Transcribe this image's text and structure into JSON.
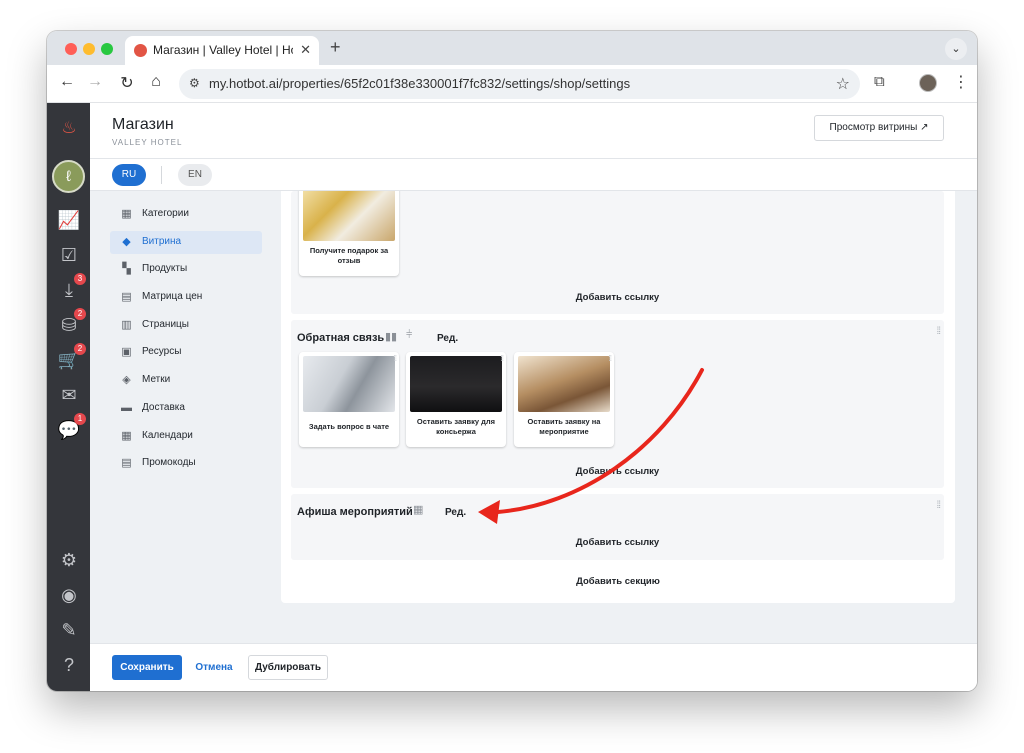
{
  "browser": {
    "tab_title": "Магазин | Valley Hotel | Hotbot",
    "tab_close": "✕",
    "new_tab": "+",
    "tab_menu": "⌄",
    "url": "my.hotbot.ai/properties/65f2c01f38e330001f7fc832/settings/shop/settings",
    "icons": [
      "back-icon",
      "forward-icon",
      "reload-icon",
      "home-icon",
      "site-settings-icon",
      "star-icon",
      "extensions-icon",
      "profile-avatar",
      "more-menu-icon"
    ]
  },
  "leftbar": {
    "badges": {
      "inbox": "3",
      "orders": "2",
      "cart": "2",
      "chat": "1"
    },
    "brand_glyph": "ℓ"
  },
  "header": {
    "title": "Магазин",
    "subtitle": "VALLEY HOTEL",
    "preview_label": "Просмотр витрины ↗"
  },
  "languages": {
    "ru": "RU",
    "en": "EN"
  },
  "subnav": {
    "items": [
      {
        "label": "Категории",
        "icon": "store-icon"
      },
      {
        "label": "Витрина",
        "icon": "showcase-icon"
      },
      {
        "label": "Продукты",
        "icon": "products-icon"
      },
      {
        "label": "Матрица цен",
        "icon": "price-matrix-icon"
      },
      {
        "label": "Страницы",
        "icon": "pages-icon"
      },
      {
        "label": "Ресурсы",
        "icon": "resources-icon"
      },
      {
        "label": "Метки",
        "icon": "tag-icon"
      },
      {
        "label": "Доставка",
        "icon": "delivery-icon"
      },
      {
        "label": "Календари",
        "icon": "calendar-icon"
      },
      {
        "label": "Промокоды",
        "icon": "promo-icon"
      }
    ]
  },
  "sections": {
    "first": {
      "cards": [
        {
          "label": "Получите подарок за отзыв"
        }
      ],
      "add_link": "Добавить ссылку"
    },
    "feedback": {
      "title": "Обратная связь",
      "edit": "Ред.",
      "cards": [
        {
          "label": "Задать вопрос в чате"
        },
        {
          "label": "Оставить заявку для консьержа"
        },
        {
          "label": "Оставить заявку на мероприятие"
        }
      ],
      "add_link": "Добавить ссылку"
    },
    "events": {
      "title": "Афиша мероприятий",
      "edit": "Ред.",
      "add_link": "Добавить ссылку"
    },
    "add_section": "Добавить секцию"
  },
  "footer": {
    "save": "Сохранить",
    "cancel": "Отмена",
    "duplicate": "Дублировать"
  },
  "colors": {
    "accent": "#1f6fd1",
    "sidebar": "#34363b",
    "annotation_arrow": "#e8261c",
    "badge": "#e5484d"
  }
}
